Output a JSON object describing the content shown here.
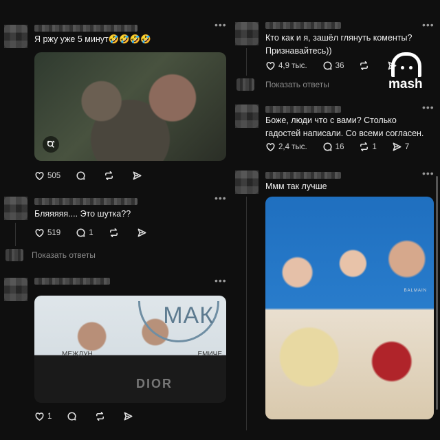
{
  "brand": {
    "logo_text": "mash"
  },
  "left_column": {
    "posts": [
      {
        "text": "Я ржу уже 5 минут🤣🤣🤣🤣",
        "has_media": true,
        "actions": {
          "likes": "505",
          "comments": "",
          "reposts": "",
          "shares": ""
        }
      },
      {
        "text": "Бляяяяя.... Это шутка??",
        "has_media": false,
        "actions": {
          "likes": "519",
          "comments": "1",
          "reposts": "",
          "shares": ""
        },
        "show_replies": "Показать ответы"
      },
      {
        "text": "",
        "has_media": true,
        "media_brand_text": "МАК",
        "media_caption_left": "МЕЖДУН",
        "media_caption_right": "ЕМИЧЕ",
        "shirt_text": "DIOR",
        "actions": {
          "likes": "1",
          "comments": "",
          "reposts": "",
          "shares": ""
        }
      }
    ]
  },
  "right_column": {
    "posts": [
      {
        "text": "Кто как и я, зашёл глянуть коменты? Признавайтесь))",
        "actions": {
          "likes": "4,9 тыс.",
          "comments": "36",
          "reposts": "",
          "shares": ""
        },
        "show_replies": "Показать ответы"
      },
      {
        "text": "Боже, люди что с вами? Столько гадостей написали. Со всеми согласен.",
        "actions": {
          "likes": "2,4 тыс.",
          "comments": "16",
          "reposts": "1",
          "shares": "7"
        }
      },
      {
        "text": "Ммм так лучше",
        "has_media": true,
        "shirt_text": "BALMAIN"
      }
    ]
  },
  "icons": {
    "like": "heart-icon",
    "comment": "comment-bubble-icon",
    "repost": "repost-arrows-icon",
    "share": "send-arrow-icon",
    "more": "more-dots-icon",
    "image": "image-search-icon"
  }
}
